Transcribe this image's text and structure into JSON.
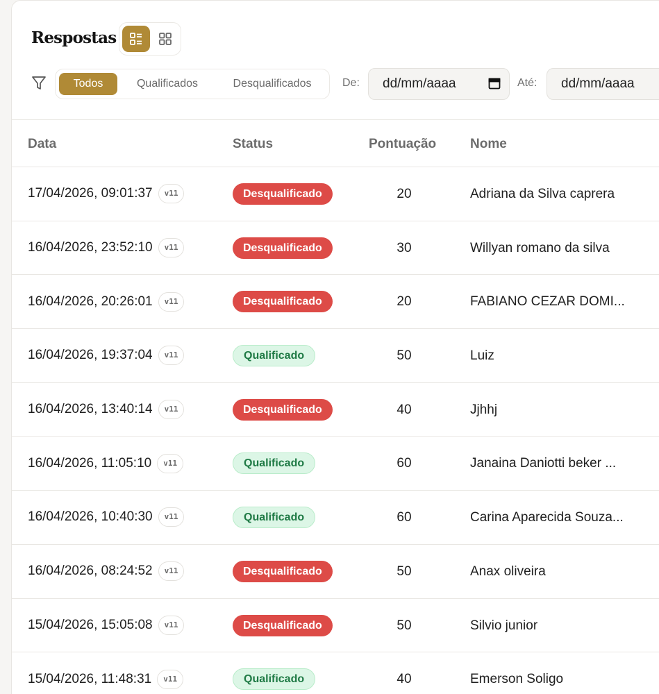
{
  "header": {
    "title": "Respostas",
    "view_icons": [
      "list-view-icon",
      "grid-view-icon"
    ]
  },
  "filters": {
    "icon": "filter-icon",
    "segments": [
      "Todos",
      "Qualificados",
      "Desqualificados"
    ],
    "active_segment": "Todos",
    "from_label": "De:",
    "from_placeholder": "dd/mm/aaaa",
    "to_label": "Até:",
    "to_placeholder": "dd/mm/aaaa"
  },
  "table": {
    "columns": [
      "Data",
      "Status",
      "Pontuação",
      "Nome"
    ],
    "rows": [
      {
        "date": "17/04/2026, 09:01:37",
        "version": "v11",
        "status": "Desqualificado",
        "score": "20",
        "name": "Adriana da Silva caprera"
      },
      {
        "date": "16/04/2026, 23:52:10",
        "version": "v11",
        "status": "Desqualificado",
        "score": "30",
        "name": "Willyan romano da silva"
      },
      {
        "date": "16/04/2026, 20:26:01",
        "version": "v11",
        "status": "Desqualificado",
        "score": "20",
        "name": "FABIANO CEZAR DOMI..."
      },
      {
        "date": "16/04/2026, 19:37:04",
        "version": "v11",
        "status": "Qualificado",
        "score": "50",
        "name": "Luiz"
      },
      {
        "date": "16/04/2026, 13:40:14",
        "version": "v11",
        "status": "Desqualificado",
        "score": "40",
        "name": "Jjhhj"
      },
      {
        "date": "16/04/2026, 11:05:10",
        "version": "v11",
        "status": "Qualificado",
        "score": "60",
        "name": "Janaina Daniotti beker ..."
      },
      {
        "date": "16/04/2026, 10:40:30",
        "version": "v11",
        "status": "Qualificado",
        "score": "60",
        "name": "Carina Aparecida Souza..."
      },
      {
        "date": "16/04/2026, 08:24:52",
        "version": "v11",
        "status": "Desqualificado",
        "score": "50",
        "name": "Anax oliveira"
      },
      {
        "date": "15/04/2026, 15:05:08",
        "version": "v11",
        "status": "Desqualificado",
        "score": "50",
        "name": "Silvio junior"
      },
      {
        "date": "15/04/2026, 11:48:31",
        "version": "v11",
        "status": "Qualificado",
        "score": "40",
        "name": "Emerson Soligo"
      }
    ]
  },
  "colors": {
    "accent": "#b08a36",
    "disqualified": "#dd4b47",
    "qualified_bg": "#dcf6e6",
    "qualified_text": "#1f7a45"
  }
}
